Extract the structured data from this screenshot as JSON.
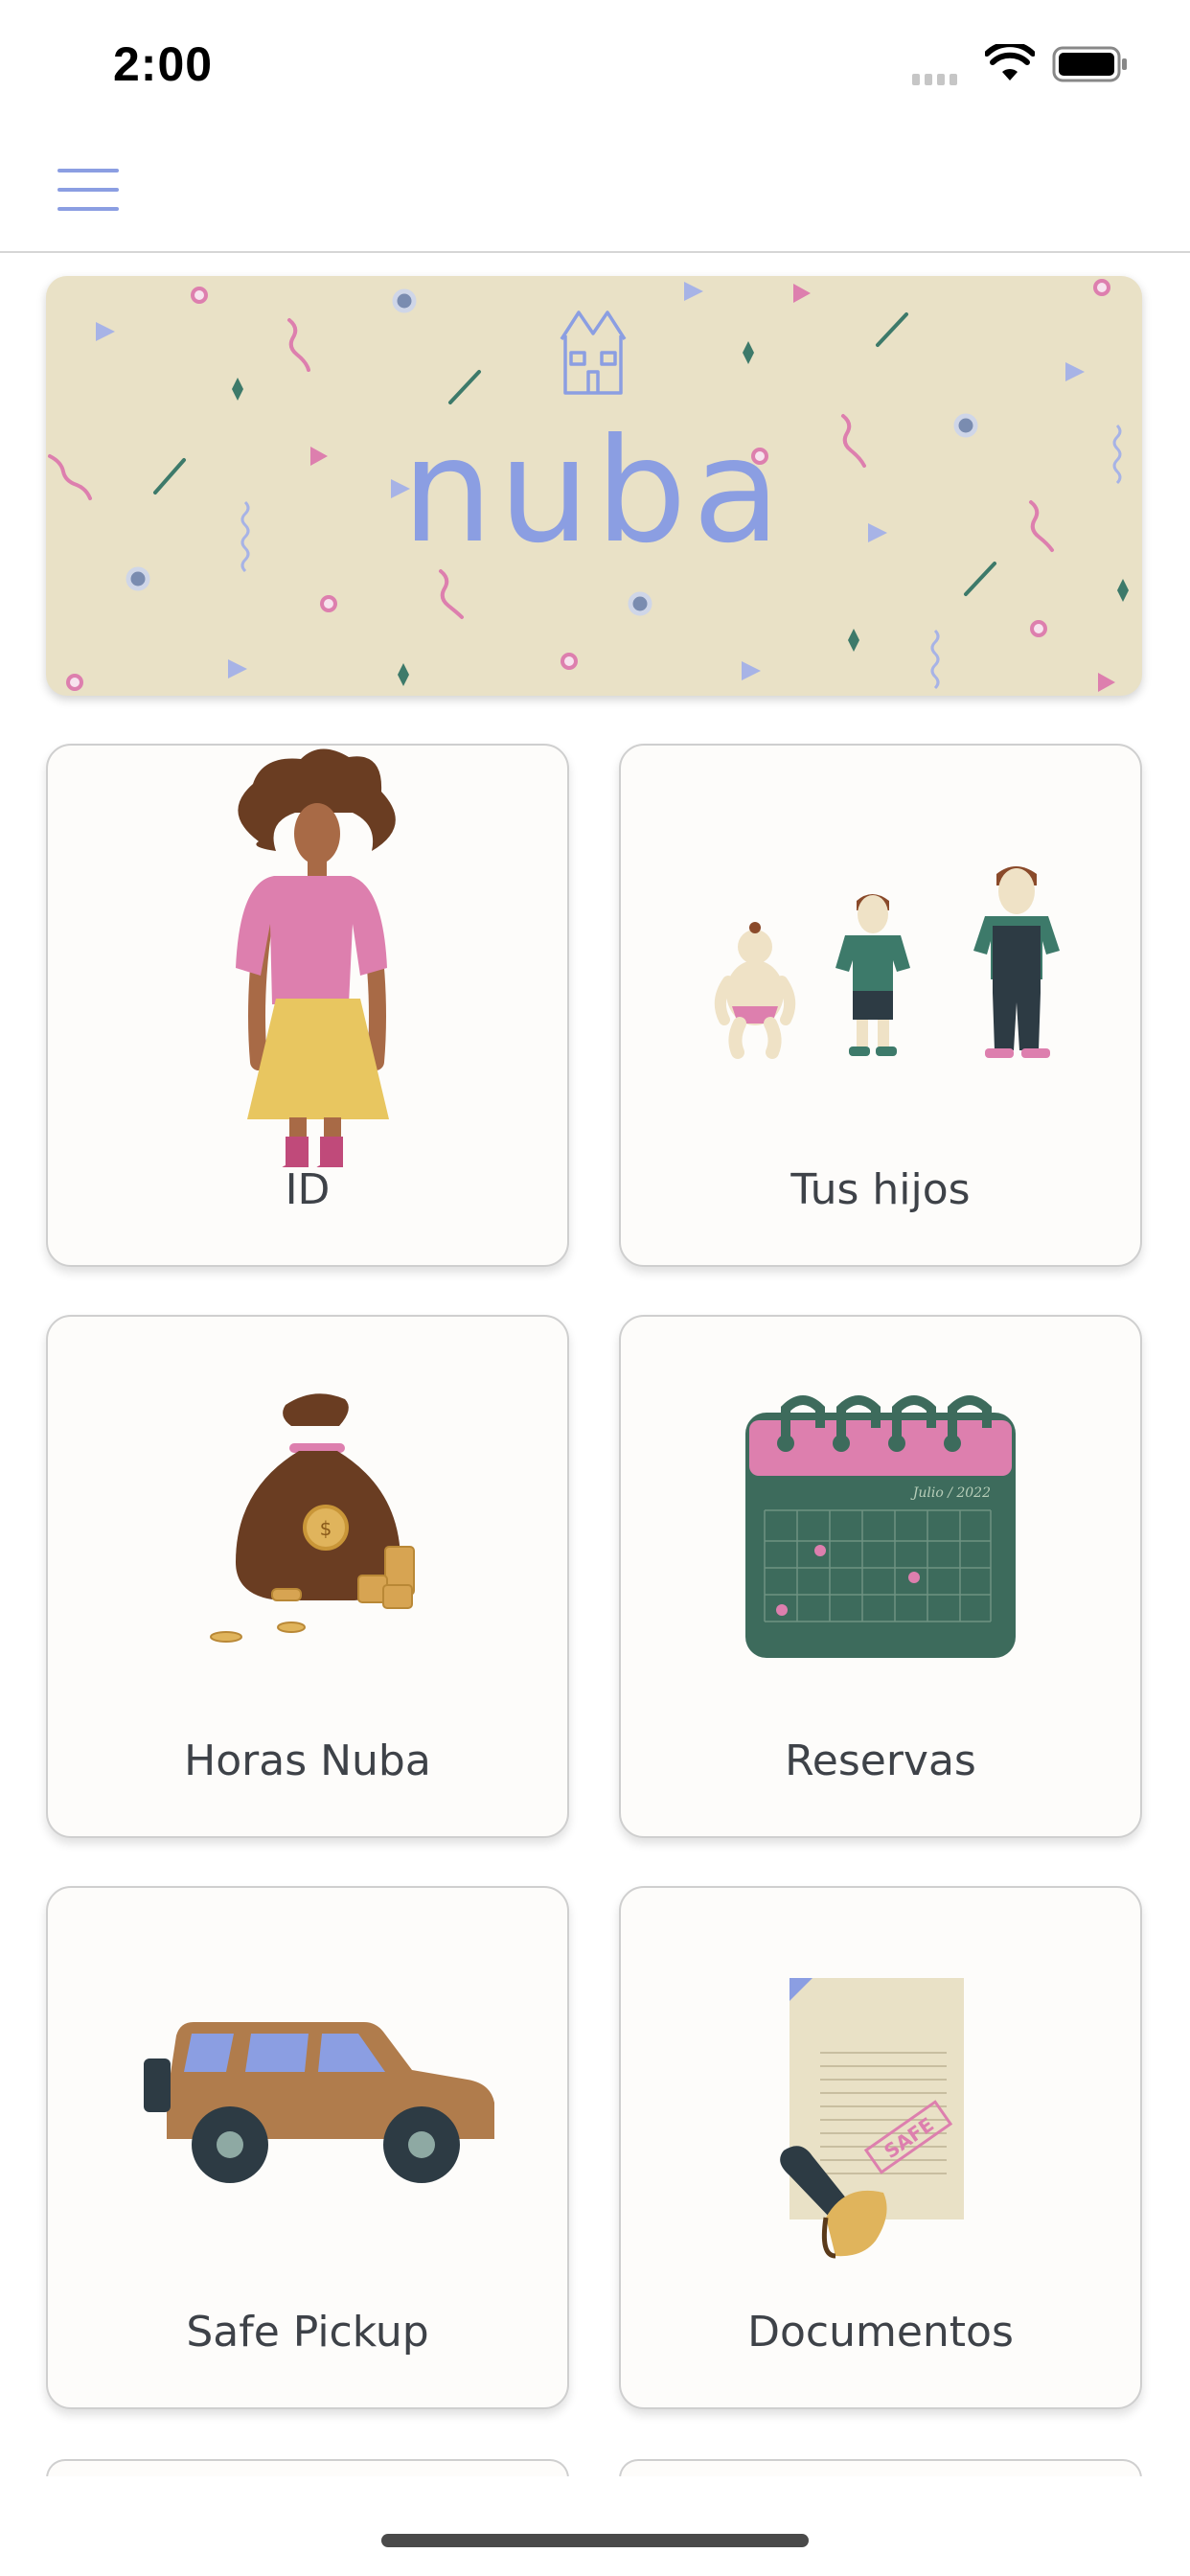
{
  "status_bar": {
    "time": "2:00"
  },
  "top_bar": {
    "menu_icon": "hamburger-menu-icon"
  },
  "banner": {
    "brand": "nuba",
    "icon": "house-icon"
  },
  "tiles": [
    {
      "label": "ID",
      "icon": "woman-illustration"
    },
    {
      "label": "Tus hijos",
      "icon": "children-illustration"
    },
    {
      "label": "Horas Nuba",
      "icon": "money-bag-illustration"
    },
    {
      "label": "Reservas",
      "icon": "calendar-illustration",
      "calendar_month": "Julio / 2022"
    },
    {
      "label": "Safe Pickup",
      "icon": "car-illustration"
    },
    {
      "label": "Documentos",
      "icon": "document-stamp-illustration",
      "stamp_text": "SAFE"
    }
  ],
  "colors": {
    "accent": "#8b9ee2",
    "banner_bg": "#e9e1c6",
    "pink": "#dd7fae",
    "green": "#3d6b5c",
    "brown": "#7a4a2a"
  }
}
